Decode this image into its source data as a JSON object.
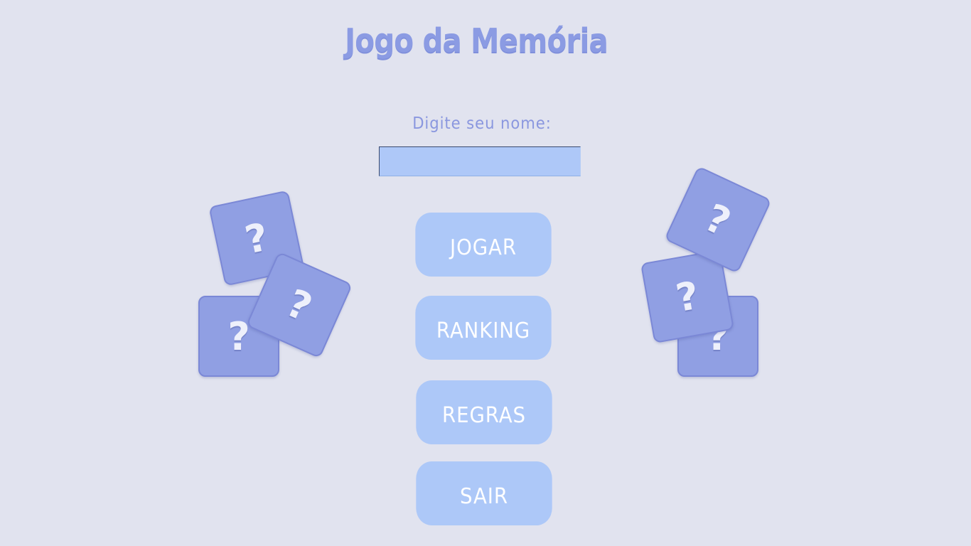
{
  "title": "Jogo da Memória",
  "name_prompt": {
    "label": "Digite seu nome:",
    "value": ""
  },
  "menu": {
    "play_label": "JOGAR",
    "ranking_label": "RANKING",
    "rules_label": "REGRAS",
    "exit_label": "SAIR"
  },
  "cards": {
    "symbol": "?",
    "face_color": "#909fe3",
    "icon": "question-mark-icon"
  },
  "colors": {
    "background": "#e1e3ef",
    "title": "#8b9be3",
    "button": "#adc8f8",
    "button_text": "#ffffff",
    "input": "#aec8f8"
  }
}
